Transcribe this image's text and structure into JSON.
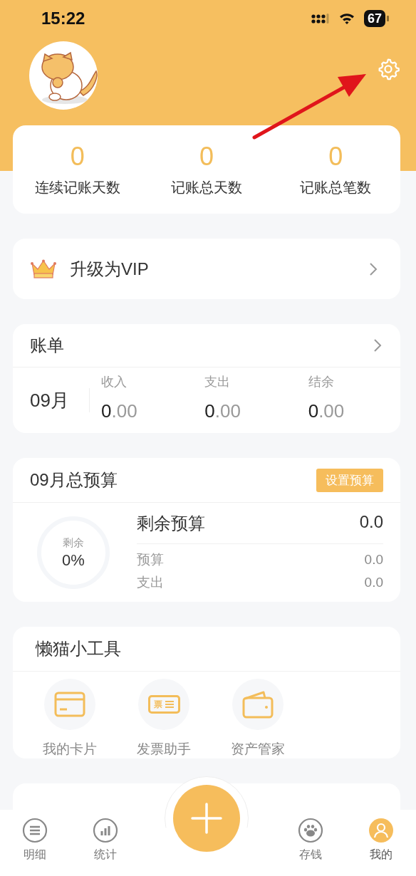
{
  "status_bar": {
    "time": "15:22",
    "battery": "67"
  },
  "annotation_arrow": true,
  "stats": [
    {
      "value": "0",
      "label": "连续记账天数"
    },
    {
      "value": "0",
      "label": "记账总天数"
    },
    {
      "value": "0",
      "label": "记账总笔数"
    }
  ],
  "vip": {
    "label": "升级为VIP"
  },
  "bill": {
    "title": "账单",
    "month": "09月",
    "columns": [
      {
        "label": "收入",
        "whole": "0",
        "fraction": ".00"
      },
      {
        "label": "支出",
        "whole": "0",
        "fraction": ".00"
      },
      {
        "label": "结余",
        "whole": "0",
        "fraction": ".00"
      }
    ]
  },
  "budget": {
    "title": "09月总预算",
    "button": "设置预算",
    "ring": {
      "label": "剩余",
      "percent": "0%"
    },
    "remaining_label": "剩余预算",
    "remaining_value": "0.0",
    "rows": [
      {
        "label": "预算",
        "value": "0.0"
      },
      {
        "label": "支出",
        "value": "0.0"
      }
    ]
  },
  "tools": {
    "title": "懒猫小工具",
    "items": [
      {
        "label": "我的卡片",
        "kind": "card"
      },
      {
        "label": "发票助手",
        "kind": "invoice",
        "icon_text": "票"
      },
      {
        "label": "资产管家",
        "kind": "wallet"
      }
    ]
  },
  "tab_bar": [
    {
      "label": "明细",
      "kind": "list",
      "selected": false
    },
    {
      "label": "统计",
      "kind": "chart",
      "selected": false
    },
    {
      "label": "存钱",
      "kind": "paw",
      "selected": false
    },
    {
      "label": "我的",
      "kind": "person",
      "selected": true
    }
  ]
}
